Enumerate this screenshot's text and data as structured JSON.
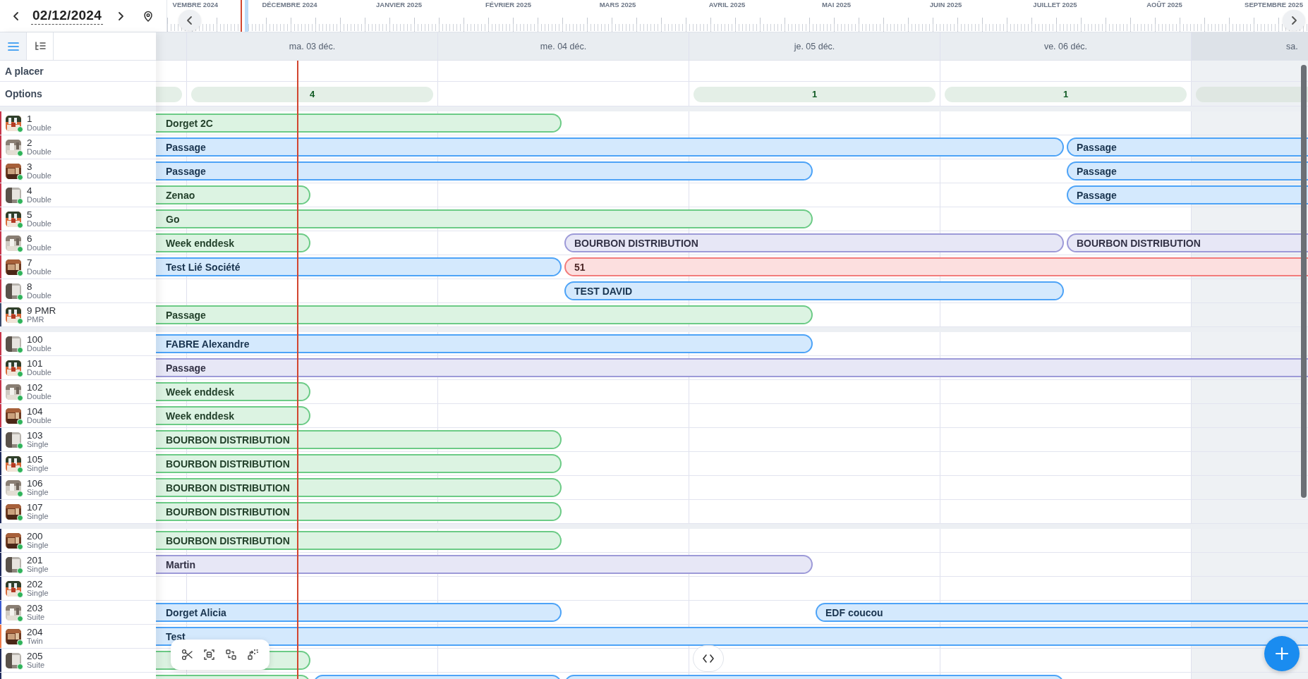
{
  "date_picker": {
    "value": "02/12/2024"
  },
  "timeline": {
    "months": [
      "VEMBRE 2024",
      "DÉCEMBRE 2024",
      "JANVIER 2025",
      "FÉVRIER 2025",
      "MARS 2025",
      "AVRIL 2025",
      "MAI 2025",
      "JUIN 2025",
      "JUILLET 2025",
      "AOÛT 2025",
      "SEPTEMBRE 2025"
    ]
  },
  "view_buttons": [
    {
      "selected": true
    },
    {
      "selected": false
    }
  ],
  "row_labels": {
    "unplaced": "A placer",
    "options": "Options"
  },
  "days": [
    {
      "has_option": true,
      "weekend": false
    },
    {
      "label": "ma. 03 déc.",
      "has_option": true,
      "option_count": "4",
      "weekend": false
    },
    {
      "label": "me. 04 déc.",
      "has_option": false,
      "weekend": false
    },
    {
      "label": "je. 05 déc.",
      "has_option": true,
      "option_count": "1",
      "weekend": false
    },
    {
      "label": "ve. 06 déc.",
      "has_option": true,
      "option_count": "1",
      "weekend": false
    },
    {
      "label": "sa.",
      "has_option": true,
      "weekend": true
    }
  ],
  "room_groups": [
    {
      "rooms": [
        {
          "number": "1",
          "type": "Double",
          "color": "#c8354b",
          "bookings": [
            {
              "label": "Dorget 2C",
              "color": "#6ccb86"
            }
          ]
        },
        {
          "number": "2",
          "type": "Double",
          "color": "#c8354b",
          "bookings": [
            {
              "label": "Passage",
              "color": "#4da3f7"
            },
            {
              "label": "Passage",
              "color": "#4da3f7"
            }
          ]
        },
        {
          "number": "3",
          "type": "Double",
          "color": "#c8354b",
          "bookings": [
            {
              "label": "Passage",
              "color": "#4da3f7"
            },
            {
              "label": "Passage",
              "color": "#4da3f7"
            }
          ]
        },
        {
          "number": "4",
          "type": "Double",
          "color": "#c8354b",
          "bookings": [
            {
              "label": "Zenao",
              "color": "#6ccb86"
            },
            {
              "label": "Passage",
              "color": "#4da3f7"
            }
          ]
        },
        {
          "number": "5",
          "type": "Double",
          "color": "#c8354b",
          "bookings": [
            {
              "label": "Go",
              "color": "#6ccb86"
            }
          ]
        },
        {
          "number": "6",
          "type": "Double",
          "color": "#c8354b",
          "bookings": [
            {
              "label": "Week enddesk",
              "color": "#6ccb86"
            },
            {
              "label": "BOURBON DISTRIBUTION",
              "color": "#9d9ad8"
            },
            {
              "label": "BOURBON DISTRIBUTION",
              "color": "#9d9ad8"
            }
          ]
        },
        {
          "number": "7",
          "type": "Double",
          "color": "#c8354b",
          "bookings": [
            {
              "label": "Test Lié Société",
              "color": "#4da3f7"
            },
            {
              "label": "51",
              "color": "#f27b7b"
            }
          ]
        },
        {
          "number": "8",
          "type": "Double",
          "color": "#c8354b",
          "bookings": [
            {
              "label": "TEST DAVID",
              "color": "#4da3f7"
            }
          ]
        },
        {
          "number": "9 PMR",
          "type": "PMR",
          "color": "#3b4a6b",
          "bookings": [
            {
              "label": "Passage",
              "color": "#6ccb86"
            }
          ]
        }
      ]
    },
    {
      "rooms": [
        {
          "number": "100",
          "type": "Double",
          "color": "#c8354b",
          "bookings": [
            {
              "label": "FABRE Alexandre",
              "color": "#4da3f7"
            }
          ]
        },
        {
          "number": "101",
          "type": "Double",
          "color": "#c8354b",
          "bookings": [
            {
              "label": "Passage",
              "color": "#9d9ad8"
            }
          ]
        },
        {
          "number": "102",
          "type": "Double",
          "color": "#c8354b",
          "bookings": [
            {
              "label": "Week enddesk",
              "color": "#6ccb86"
            }
          ]
        },
        {
          "number": "104",
          "type": "Double",
          "color": "#c8354b",
          "bookings": [
            {
              "label": "Week enddesk",
              "color": "#6ccb86"
            }
          ]
        },
        {
          "number": "103",
          "type": "Single",
          "color": "#1f2a5c",
          "bookings": [
            {
              "label": "BOURBON DISTRIBUTION",
              "color": "#6ccb86"
            }
          ]
        },
        {
          "number": "105",
          "type": "Single",
          "color": "#1f2a5c",
          "bookings": [
            {
              "label": "BOURBON DISTRIBUTION",
              "color": "#6ccb86"
            }
          ]
        },
        {
          "number": "106",
          "type": "Single",
          "color": "#1f2a5c",
          "bookings": [
            {
              "label": "BOURBON DISTRIBUTION",
              "color": "#6ccb86"
            }
          ]
        },
        {
          "number": "107",
          "type": "Single",
          "color": "#1f2a5c",
          "bookings": [
            {
              "label": "BOURBON DISTRIBUTION",
              "color": "#6ccb86"
            }
          ]
        }
      ]
    },
    {
      "rooms": [
        {
          "number": "200",
          "type": "Single",
          "color": "#1f2a5c",
          "bookings": [
            {
              "label": "BOURBON DISTRIBUTION",
              "color": "#6ccb86"
            }
          ]
        },
        {
          "number": "201",
          "type": "Single",
          "color": "#1f2a5c",
          "bookings": [
            {
              "label": "Martin",
              "color": "#9d9ad8"
            }
          ]
        },
        {
          "number": "202",
          "type": "Single",
          "color": "#1f2a5c"
        },
        {
          "number": "203",
          "type": "Suite",
          "color": "#3a5bd0",
          "bookings": [
            {
              "label": "Dorget Alicia",
              "color": "#4da3f7"
            },
            {
              "label": "EDF coucou",
              "color": "#4da3f7"
            }
          ]
        },
        {
          "number": "204",
          "type": "Twin",
          "color": "#f07a4a",
          "bookings": [
            {
              "label": "Test",
              "color": "#4da3f7"
            }
          ]
        },
        {
          "number": "205",
          "type": "Suite",
          "color": "#1f2a5c",
          "bookings": [
            {
              "color": "#6ccb86"
            }
          ]
        },
        {
          "color": "#1f2a5c",
          "bookings": [
            {
              "color": "#6ccb86"
            },
            {
              "color": "#4da3f7"
            },
            {
              "color": "#4da3f7"
            }
          ]
        }
      ]
    }
  ]
}
